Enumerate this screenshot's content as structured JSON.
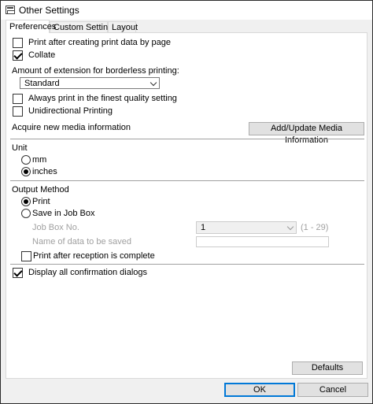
{
  "window": {
    "title": "Other Settings"
  },
  "tabs": [
    "Preferences",
    "Custom Settings",
    "Layout"
  ],
  "preferences": {
    "print_after_creating": "Print after creating print data by page",
    "collate": "Collate",
    "extension_label": "Amount of extension for borderless printing:",
    "extension_value": "Standard",
    "always_finest": "Always print in the finest quality setting",
    "unidirectional": "Unidirectional Printing",
    "acquire_media": "Acquire new media information",
    "add_update_button": "Add/Update Media Information"
  },
  "unit": {
    "label": "Unit",
    "mm": "mm",
    "inches": "inches",
    "selected": "inches"
  },
  "output": {
    "label": "Output Method",
    "print": "Print",
    "save_job_box": "Save in Job Box",
    "selected": "Print",
    "job_box_no_label": "Job Box No.",
    "job_box_no_value": "1",
    "job_box_range": "(1 - 29)",
    "data_name_label": "Name of data to be saved",
    "data_name_value": "",
    "print_after_reception": "Print after reception is complete"
  },
  "display_confirmation": "Display all confirmation dialogs",
  "checkboxes": {
    "print_after_creating": false,
    "collate": true,
    "always_finest": false,
    "unidirectional": false,
    "print_after_reception": false,
    "display_confirmation": true
  },
  "buttons": {
    "defaults": "Defaults",
    "ok": "OK",
    "cancel": "Cancel"
  }
}
